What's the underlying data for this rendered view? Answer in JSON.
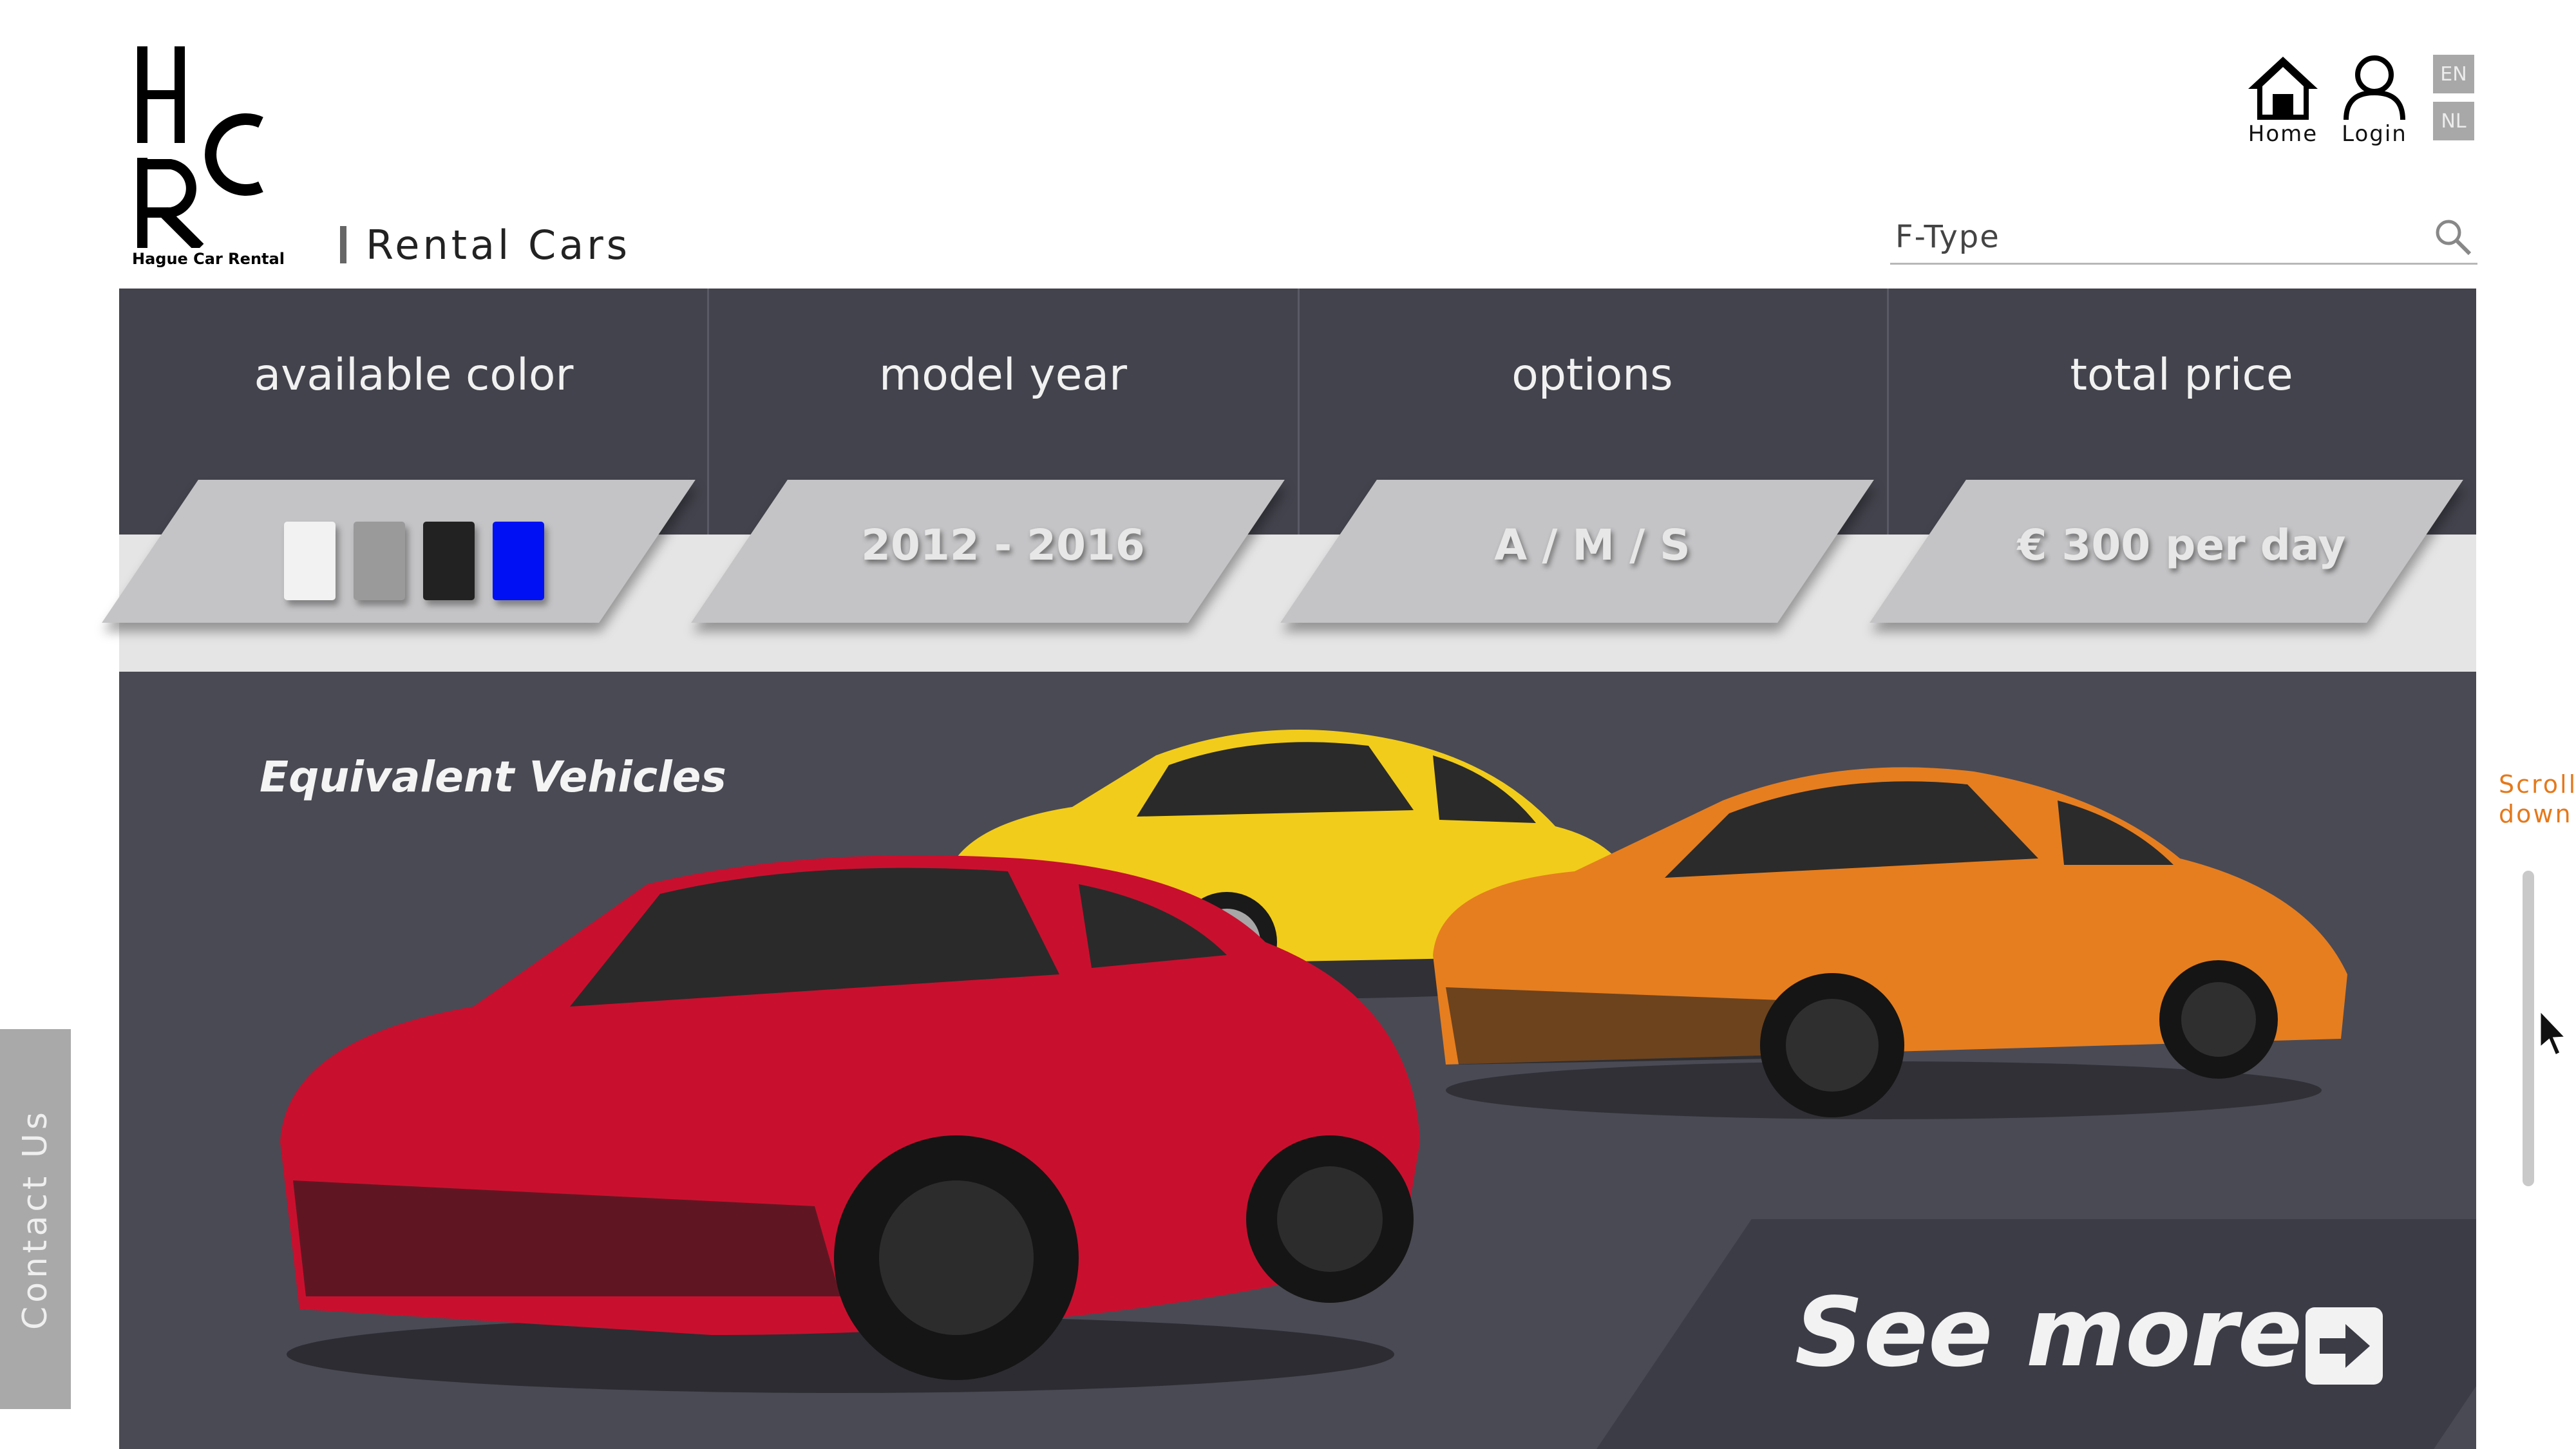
{
  "header": {
    "logo_letters": "HCR",
    "brand_name": "Hague Car Rental",
    "section_title": "Rental Cars",
    "nav": [
      {
        "label": "Home",
        "icon": "home-icon"
      },
      {
        "label": "Login",
        "icon": "user-icon"
      }
    ],
    "languages": [
      "EN",
      "NL"
    ],
    "search": {
      "value": "F-Type",
      "icon": "search-icon"
    }
  },
  "specs": [
    {
      "label": "available color",
      "colors": [
        "#f2f2f2",
        "#9a9a9a",
        "#222222",
        "#0010f5"
      ]
    },
    {
      "label": "model year",
      "value": "2012 - 2016"
    },
    {
      "label": "options",
      "value": "A / M / S"
    },
    {
      "label": "total price",
      "value": "€ 300 per day"
    }
  ],
  "vehicles": {
    "title": "Equivalent Vehicles",
    "cars": [
      {
        "name": "yellow coupe",
        "color": "#f2cc1a"
      },
      {
        "name": "orange GT",
        "color": "#e67e1f"
      },
      {
        "name": "red muscle car",
        "color": "#c8102e"
      }
    ],
    "see_more_label": "See more",
    "see_more_icon": "arrow-right-icon"
  },
  "sidebar": {
    "contact_label": "Contact Us",
    "scroll_label_1": "Scroll",
    "scroll_label_2": "down"
  },
  "colors": {
    "dark_panel": "#43434d",
    "vehicles_bg": "#4a4a54",
    "accent_orange": "#e5791c",
    "badge_gray": "#a8a8a8"
  }
}
